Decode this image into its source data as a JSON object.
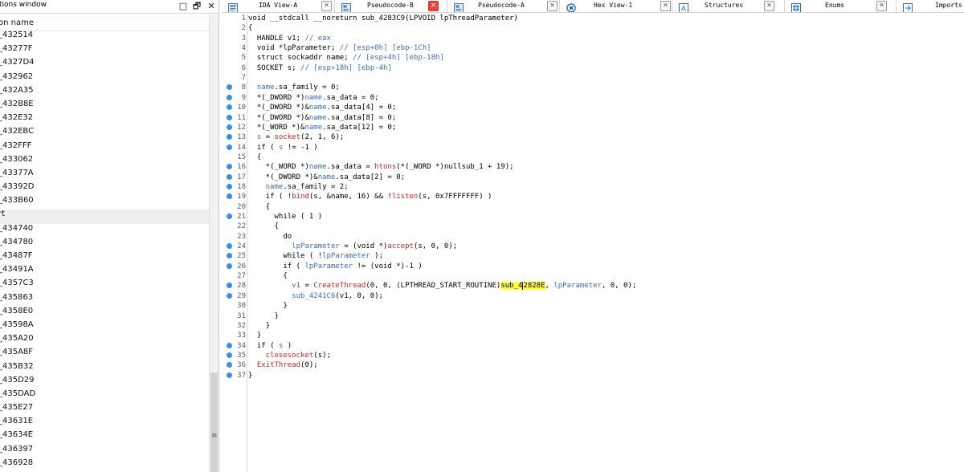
{
  "functions_window": {
    "title": "tions window",
    "column_header": "on name",
    "items": [
      "_432514",
      "_43277F",
      "_4327D4",
      "_432962",
      "_432A35",
      "_432B8E",
      "_432E32",
      "_432EBC",
      "_432FFF",
      "_433062",
      "_43377A",
      "_43392D",
      "_433B60",
      "rt",
      "_434740",
      "_434780",
      "_43487F",
      "_43491A",
      "_4357C3",
      "_435863",
      "_4358E0",
      "_43598A",
      "_435A20",
      "_435A8F",
      "_435B32",
      "_435D29",
      "_435DAD",
      "_435E27",
      "_43631E",
      "_43634E",
      "_436397",
      "_436928"
    ],
    "selected_index": 13,
    "buttons": {
      "restore": "□",
      "float": "🗗",
      "close": "✕"
    },
    "scroll_grip": "≡"
  },
  "tabs": [
    {
      "label": "IDA View-A",
      "icon": "ida-view-icon",
      "active": false
    },
    {
      "label": "Pseudocode-B",
      "icon": "pseudocode-icon",
      "active": true
    },
    {
      "label": "Pseudocode-A",
      "icon": "pseudocode-icon",
      "active": false
    },
    {
      "label": "Hex View-1",
      "icon": "hex-view-icon",
      "active": false
    },
    {
      "label": "Structures",
      "icon": "structures-icon",
      "active": false
    },
    {
      "label": "Enums",
      "icon": "enums-icon",
      "active": false
    },
    {
      "label": "Imports",
      "icon": "imports-icon",
      "active": false
    }
  ],
  "tab_close_glyph": "✕",
  "colors": {
    "accent_blue": "#3a8ee6",
    "highlight": "#ffff3a",
    "api_red": "#cc2626",
    "var_blue": "#3e6dc2"
  },
  "code": {
    "lines": [
      {
        "n": "1",
        "dot": false,
        "tokens": [
          [
            "k",
            "void __stdcall __noreturn sub_4283C9(LPVOID lpThreadParameter)"
          ]
        ]
      },
      {
        "n": "2",
        "dot": false,
        "tokens": [
          [
            "k",
            "{"
          ]
        ]
      },
      {
        "n": "3",
        "dot": false,
        "tokens": [
          [
            "k",
            "  HANDLE v1; "
          ],
          [
            "c",
            "// eax"
          ]
        ]
      },
      {
        "n": "4",
        "dot": false,
        "tokens": [
          [
            "k",
            "  void *lpParameter; "
          ],
          [
            "c",
            "// [esp+0h] [ebp-1Ch]"
          ]
        ]
      },
      {
        "n": "5",
        "dot": false,
        "tokens": [
          [
            "k",
            "  struct sockaddr name; "
          ],
          [
            "c",
            "// [esp+4h] [ebp-18h]"
          ]
        ]
      },
      {
        "n": "6",
        "dot": false,
        "tokens": [
          [
            "k",
            "  SOCKET s; "
          ],
          [
            "c",
            "// [esp+18h] [ebp-4h]"
          ]
        ]
      },
      {
        "n": "7",
        "dot": false,
        "tokens": [
          [
            "k",
            ""
          ]
        ]
      },
      {
        "n": "8",
        "dot": true,
        "tokens": [
          [
            "v",
            "  name"
          ],
          [
            "k",
            ".sa_family = 0;"
          ]
        ]
      },
      {
        "n": "9",
        "dot": true,
        "tokens": [
          [
            "k",
            "  *(_DWORD *)"
          ],
          [
            "v",
            "name"
          ],
          [
            "k",
            ".sa_data = 0;"
          ]
        ]
      },
      {
        "n": "10",
        "dot": true,
        "tokens": [
          [
            "k",
            "  *(_DWORD *)&"
          ],
          [
            "v",
            "name"
          ],
          [
            "k",
            ".sa_data[4] = 0;"
          ]
        ]
      },
      {
        "n": "11",
        "dot": true,
        "tokens": [
          [
            "k",
            "  *(_DWORD *)&"
          ],
          [
            "v",
            "name"
          ],
          [
            "k",
            ".sa_data[8] = 0;"
          ]
        ]
      },
      {
        "n": "12",
        "dot": true,
        "tokens": [
          [
            "k",
            "  *(_WORD *)&"
          ],
          [
            "v",
            "name"
          ],
          [
            "k",
            ".sa_data[12] = 0;"
          ]
        ]
      },
      {
        "n": "13",
        "dot": true,
        "tokens": [
          [
            "v",
            "  s"
          ],
          [
            "k",
            " = "
          ],
          [
            "f",
            "socket"
          ],
          [
            "k",
            "(2, 1, 6);"
          ]
        ]
      },
      {
        "n": "14",
        "dot": true,
        "tokens": [
          [
            "k",
            "  if ( "
          ],
          [
            "v",
            "s"
          ],
          [
            "k",
            " != -1 )"
          ]
        ]
      },
      {
        "n": "15",
        "dot": false,
        "tokens": [
          [
            "k",
            "  {"
          ]
        ]
      },
      {
        "n": "16",
        "dot": true,
        "tokens": [
          [
            "k",
            "    *(_WORD *)"
          ],
          [
            "v",
            "name"
          ],
          [
            "k",
            ".sa_data = "
          ],
          [
            "f",
            "htons"
          ],
          [
            "k",
            "(*(_WORD *)nullsub_1 + 19);"
          ]
        ]
      },
      {
        "n": "17",
        "dot": true,
        "tokens": [
          [
            "k",
            "    *(_DWORD *)&"
          ],
          [
            "v",
            "name"
          ],
          [
            "k",
            ".sa_data[2] = 0;"
          ]
        ]
      },
      {
        "n": "18",
        "dot": true,
        "tokens": [
          [
            "v",
            "    name"
          ],
          [
            "k",
            ".sa_family = 2;"
          ]
        ]
      },
      {
        "n": "19",
        "dot": true,
        "tokens": [
          [
            "k",
            "    if ( !"
          ],
          [
            "f",
            "bind"
          ],
          [
            "k",
            "(s, &name, 16) && !"
          ],
          [
            "f",
            "listen"
          ],
          [
            "k",
            "(s, 0x7FFFFFFF) )"
          ]
        ]
      },
      {
        "n": "20",
        "dot": false,
        "tokens": [
          [
            "k",
            "    {"
          ]
        ]
      },
      {
        "n": "21",
        "dot": true,
        "tokens": [
          [
            "k",
            "      while ( 1 )"
          ]
        ]
      },
      {
        "n": "22",
        "dot": false,
        "tokens": [
          [
            "k",
            "      {"
          ]
        ]
      },
      {
        "n": "23",
        "dot": false,
        "tokens": [
          [
            "k",
            "        do"
          ]
        ]
      },
      {
        "n": "24",
        "dot": true,
        "tokens": [
          [
            "v",
            "          lpParameter"
          ],
          [
            "k",
            " = (void *)"
          ],
          [
            "f",
            "accept"
          ],
          [
            "k",
            "(s, 0, 0);"
          ]
        ]
      },
      {
        "n": "25",
        "dot": true,
        "tokens": [
          [
            "k",
            "        while ( !"
          ],
          [
            "v",
            "lpParameter"
          ],
          [
            "k",
            " );"
          ]
        ]
      },
      {
        "n": "26",
        "dot": true,
        "tokens": [
          [
            "k",
            "        if ( "
          ],
          [
            "v",
            "lpParameter"
          ],
          [
            "k",
            " != (void *)-1 )"
          ]
        ]
      },
      {
        "n": "27",
        "dot": false,
        "tokens": [
          [
            "k",
            "        {"
          ]
        ]
      },
      {
        "n": "28",
        "dot": true,
        "tokens": [
          [
            "v",
            "          v1"
          ],
          [
            "k",
            " = "
          ],
          [
            "f",
            "CreateThread"
          ],
          [
            "k",
            "(0, 0, (LPTHREAD_START_ROUTINE)"
          ],
          [
            "h",
            "sub_4"
          ],
          [
            "caret",
            ""
          ],
          [
            "h",
            "2828E"
          ],
          [
            "k",
            ", "
          ],
          [
            "v",
            "lpParameter"
          ],
          [
            "k",
            ", 0, 0);"
          ]
        ]
      },
      {
        "n": "29",
        "dot": true,
        "tokens": [
          [
            "v",
            "          sub_4241C6"
          ],
          [
            "k",
            "(v1, 0, 0);"
          ]
        ]
      },
      {
        "n": "30",
        "dot": false,
        "tokens": [
          [
            "k",
            "        }"
          ]
        ]
      },
      {
        "n": "31",
        "dot": false,
        "tokens": [
          [
            "k",
            "      }"
          ]
        ]
      },
      {
        "n": "32",
        "dot": false,
        "tokens": [
          [
            "k",
            "    }"
          ]
        ]
      },
      {
        "n": "33",
        "dot": false,
        "tokens": [
          [
            "k",
            "  }"
          ]
        ]
      },
      {
        "n": "34",
        "dot": true,
        "tokens": [
          [
            "k",
            "  if ( "
          ],
          [
            "v",
            "s"
          ],
          [
            "k",
            " )"
          ]
        ]
      },
      {
        "n": "35",
        "dot": true,
        "tokens": [
          [
            "f",
            "    closesocket"
          ],
          [
            "k",
            "(s);"
          ]
        ]
      },
      {
        "n": "36",
        "dot": true,
        "tokens": [
          [
            "f",
            "  ExitThread"
          ],
          [
            "k",
            "(0);"
          ]
        ]
      },
      {
        "n": "37",
        "dot": true,
        "tokens": [
          [
            "k",
            "}"
          ]
        ]
      }
    ]
  }
}
